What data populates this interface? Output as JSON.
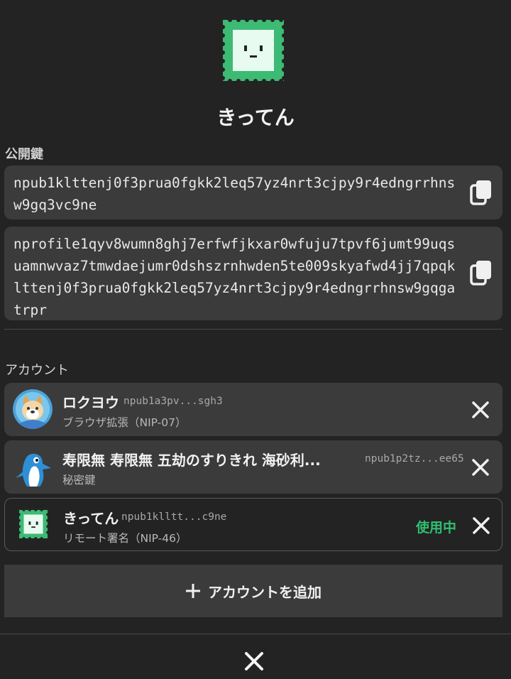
{
  "profile": {
    "display_name": "きってん"
  },
  "public_key": {
    "label": "公開鍵",
    "npub": "npub1klttenj0f3prua0fgkk2leq57yz4nrt3cjpy9r4edngrrhnsw9gq3vc9ne",
    "nprofile": "nprofile1qyv8wumn8ghj7erfwfjkxar0wfuju7tpvf6jumt99uqsuamnwvaz7tmwdaejumr0dshszrnhwden5te009skyafwd4jj7qpqklttenj0f3prua0fgkk2leq57yz4nrt3cjpy9r4edngrrhnsw9gqgatrpr"
  },
  "accounts": {
    "label": "アカウント",
    "items": [
      {
        "name": "ロクヨウ",
        "npub": "npub1a3pv...sgh3",
        "sub": "ブラウザ拡張（NIP-07）",
        "active": false
      },
      {
        "name": "寿限無 寿限無 五劫のすりきれ 海砂利...",
        "npub": "npub1p2tz...ee65",
        "sub": "秘密鍵",
        "active": false
      },
      {
        "name": "きってん",
        "npub": "npub1klltt...c9ne",
        "sub": "リモート署名（NIP-46）",
        "active": true,
        "status": "使用中"
      }
    ],
    "add_label": "アカウントを追加"
  },
  "colors": {
    "background": "#232323",
    "card": "#3b3b3b",
    "accent_green": "#2fbf71",
    "stamp_green": "#3dba74",
    "stamp_face": "#e8fbf0"
  }
}
